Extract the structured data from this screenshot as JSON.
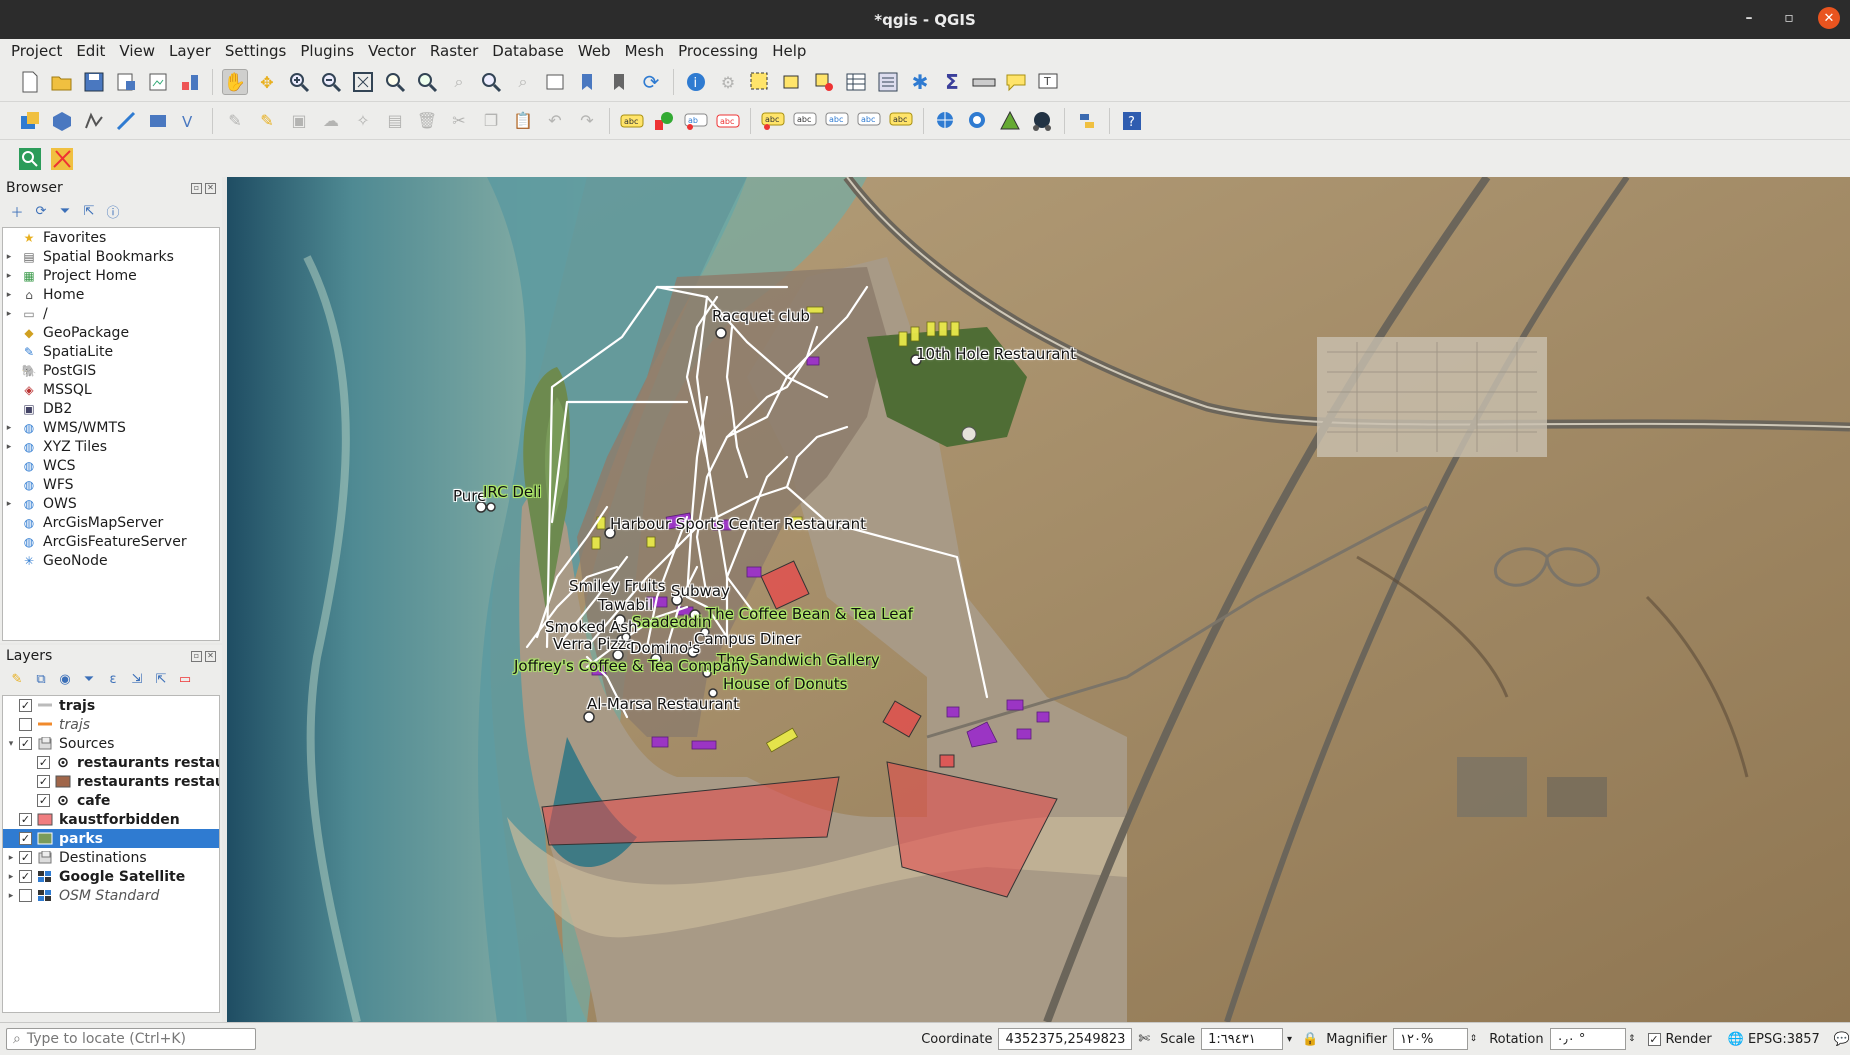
{
  "window": {
    "title": "*qgis - QGIS",
    "buttons": [
      "–",
      "▫",
      "✕"
    ]
  },
  "menu": [
    "Project",
    "Edit",
    "View",
    "Layer",
    "Settings",
    "Plugins",
    "Vector",
    "Raster",
    "Database",
    "Web",
    "Mesh",
    "Processing",
    "Help"
  ],
  "browser": {
    "title": "Browser",
    "items": [
      {
        "label": "Favorites",
        "icon": "star-icon",
        "expander": ""
      },
      {
        "label": "Spatial Bookmarks",
        "icon": "bookmark-icon",
        "expander": "▸"
      },
      {
        "label": "Project Home",
        "icon": "project-home-icon",
        "expander": "▸"
      },
      {
        "label": "Home",
        "icon": "home-folder-icon",
        "expander": "▸"
      },
      {
        "label": "/",
        "icon": "folder-icon",
        "expander": "▸"
      },
      {
        "label": "GeoPackage",
        "icon": "geopackage-icon",
        "expander": ""
      },
      {
        "label": "SpatiaLite",
        "icon": "spatialite-icon",
        "expander": ""
      },
      {
        "label": "PostGIS",
        "icon": "postgis-icon",
        "expander": ""
      },
      {
        "label": "MSSQL",
        "icon": "mssql-icon",
        "expander": ""
      },
      {
        "label": "DB2",
        "icon": "db2-icon",
        "expander": ""
      },
      {
        "label": "WMS/WMTS",
        "icon": "globe-icon",
        "expander": "▸"
      },
      {
        "label": "XYZ Tiles",
        "icon": "xyz-icon",
        "expander": "▸"
      },
      {
        "label": "WCS",
        "icon": "globe-icon",
        "expander": ""
      },
      {
        "label": "WFS",
        "icon": "globe-icon",
        "expander": ""
      },
      {
        "label": "OWS",
        "icon": "globe-icon",
        "expander": "▸"
      },
      {
        "label": "ArcGisMapServer",
        "icon": "globe-icon",
        "expander": ""
      },
      {
        "label": "ArcGisFeatureServer",
        "icon": "globe-icon",
        "expander": ""
      },
      {
        "label": "GeoNode",
        "icon": "geonode-icon",
        "expander": ""
      }
    ]
  },
  "layers": {
    "title": "Layers",
    "items": [
      {
        "label": "trajs",
        "checked": true,
        "indent": 0,
        "expander": "",
        "style": "bold",
        "symbol": "line-gray"
      },
      {
        "label": "trajs",
        "checked": false,
        "indent": 0,
        "expander": "",
        "style": "italic",
        "symbol": "line-orange"
      },
      {
        "label": "Sources",
        "checked": true,
        "indent": 0,
        "expander": "▾",
        "style": "",
        "symbol": "group"
      },
      {
        "label": "restaurants restau",
        "checked": true,
        "indent": 1,
        "expander": "",
        "style": "bold",
        "symbol": "point"
      },
      {
        "label": "restaurants restau",
        "checked": true,
        "indent": 1,
        "expander": "",
        "style": "bold",
        "symbol": "fill-brown"
      },
      {
        "label": "cafe",
        "checked": true,
        "indent": 1,
        "expander": "",
        "style": "bold",
        "symbol": "point"
      },
      {
        "label": "kaustforbidden",
        "checked": true,
        "indent": 0,
        "expander": "",
        "style": "bold",
        "symbol": "fill-pink"
      },
      {
        "label": "parks",
        "checked": true,
        "indent": 0,
        "expander": "",
        "style": "bold",
        "symbol": "fill-green",
        "selected": true
      },
      {
        "label": "Destinations",
        "checked": true,
        "indent": 0,
        "expander": "▸",
        "style": "",
        "symbol": "group"
      },
      {
        "label": "Google Satellite",
        "checked": true,
        "indent": 0,
        "expander": "▸",
        "style": "bold",
        "symbol": "raster"
      },
      {
        "label": "OSM Standard",
        "checked": false,
        "indent": 0,
        "expander": "▸",
        "style": "italic",
        "symbol": "raster"
      }
    ]
  },
  "map_labels": [
    {
      "text": "Racquet club",
      "kind": "restaurant"
    },
    {
      "text": "10th Hole Restaurant",
      "kind": "restaurant"
    },
    {
      "text": "Pure",
      "kind": "restaurant"
    },
    {
      "text": "IRC Deli",
      "kind": "cafe"
    },
    {
      "text": "Harbour Sports Center Restaurant",
      "kind": "restaurant"
    },
    {
      "text": "Smiley Fruits",
      "kind": "restaurant"
    },
    {
      "text": "Subway",
      "kind": "restaurant"
    },
    {
      "text": "Tawabil",
      "kind": "restaurant"
    },
    {
      "text": "The Coffee Bean & Tea Leaf",
      "kind": "cafe"
    },
    {
      "text": "Saadeddin",
      "kind": "cafe"
    },
    {
      "text": "Smoked Ash",
      "kind": "restaurant"
    },
    {
      "text": "Campus Diner",
      "kind": "restaurant"
    },
    {
      "text": "Verra Pizza",
      "kind": "restaurant"
    },
    {
      "text": "Domino's",
      "kind": "restaurant"
    },
    {
      "text": "The Sandwich Gallery",
      "kind": "cafe"
    },
    {
      "text": "Joffrey's Coffee & Tea Company",
      "kind": "cafe"
    },
    {
      "text": "House of Donuts",
      "kind": "cafe"
    },
    {
      "text": "Al-Marsa Restaurant",
      "kind": "restaurant"
    }
  ],
  "statusbar": {
    "locate_placeholder": "Type to locate (Ctrl+K)",
    "coordinate_label": "Coordinate",
    "coordinate_value": "4352375,2549823",
    "scale_label": "Scale",
    "scale_value": "1:٦٩٤٣١",
    "magnifier_label": "Magnifier",
    "magnifier_value": "١٢٠%",
    "rotation_label": "Rotation",
    "rotation_value": "٠٫٠ °",
    "render_label": "Render",
    "crs": "EPSG:3857"
  },
  "colors": {
    "forbidden": "#e8484b",
    "park": "#7a9b5a",
    "building": "#9b35c4",
    "yellow_bld": "#e8e84a",
    "traj": "#ffffff",
    "cafe_halo": "#aee86a",
    "selection": "#2f7bd1"
  }
}
